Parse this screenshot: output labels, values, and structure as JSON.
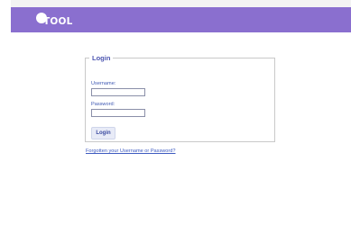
{
  "header": {
    "logo_text": "TOOL"
  },
  "login_form": {
    "legend": "Login",
    "username_label": "Username:",
    "username_value": "",
    "password_label": "Password:",
    "password_value": "",
    "submit_label": "Login"
  },
  "links": {
    "forgot": "Forgotten your Username or Password?"
  },
  "colors": {
    "header": "#8a6fcf",
    "accent": "#3e58b3"
  }
}
